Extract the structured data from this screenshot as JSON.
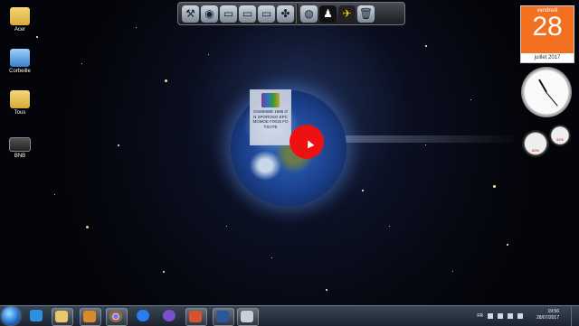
{
  "desktop_icons": [
    {
      "label": "Acer",
      "icon": "folder-icon"
    },
    {
      "label": "Corbeille",
      "icon": "recycle-bin-icon"
    },
    {
      "label": "Tous",
      "icon": "folder-icon"
    },
    {
      "label": "BNB",
      "icon": "screenshot-file-icon"
    }
  ],
  "dock": {
    "icons": [
      "tools-icon",
      "globe-icon",
      "folder-icon",
      "folder-icon",
      "folder-icon",
      "puzzle-icon",
      "globe-icon",
      "penguin-icon",
      "bird-icon",
      "trash-icon"
    ]
  },
  "file_icon": {
    "label": "OmMMWE 1995 ON SPOROSO EPCMOMOE F0015 FOTSOTE",
    "icon": "winrar-archive-icon"
  },
  "calendar": {
    "weekday": "vendredi",
    "day": "28",
    "month_year": "juillet 2017"
  },
  "clock_gadget": {
    "icon": "analog-clock-icon"
  },
  "meter_gadget": {
    "cpu": "60%",
    "ram": "31%"
  },
  "taskbar": {
    "apps": [
      "internet-explorer-icon",
      "file-explorer-icon",
      "media-player-icon",
      "chrome-icon",
      "messenger-icon",
      "viber-icon",
      "powerpoint-icon",
      "word-icon",
      "calculator-icon"
    ],
    "language": "FR",
    "time": "19:56",
    "date": "28/07/2017"
  },
  "colors": {
    "calendar_accent": "#f37021",
    "cursor_highlight": "#ee1111",
    "taskbar_bg": "#1b2330"
  }
}
